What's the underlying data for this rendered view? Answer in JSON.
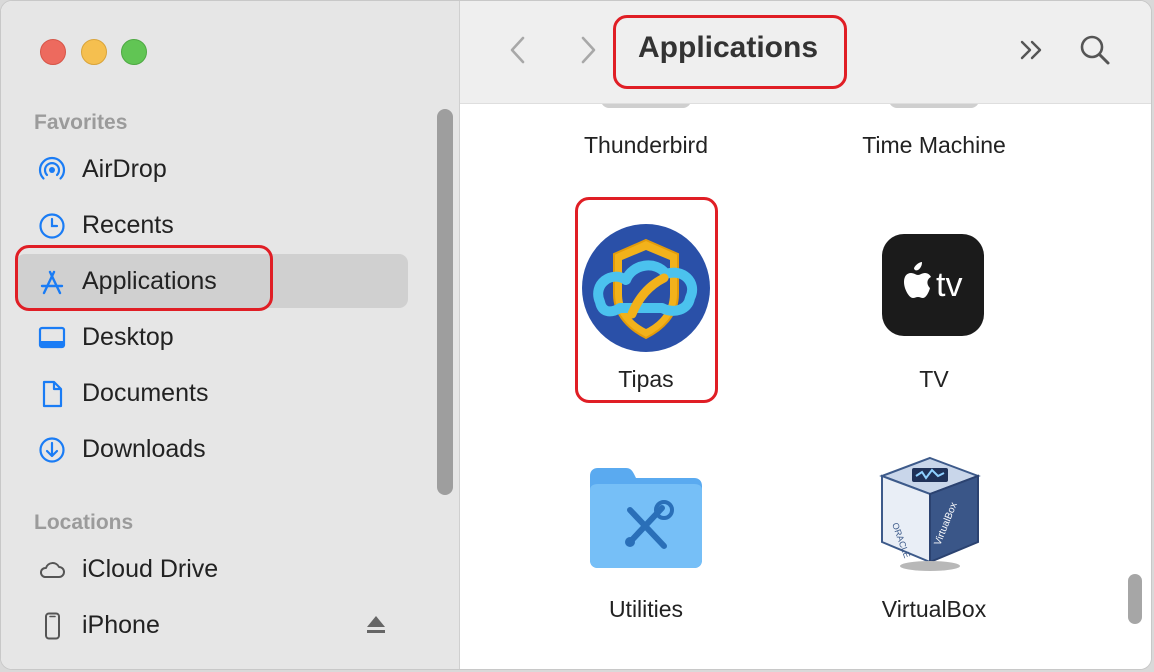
{
  "window": {
    "title": "Applications"
  },
  "sidebar": {
    "sections": [
      {
        "label": "Favorites"
      },
      {
        "label": "Locations"
      }
    ],
    "favorites": [
      {
        "label": "AirDrop",
        "icon": "airdrop-icon"
      },
      {
        "label": "Recents",
        "icon": "clock-icon"
      },
      {
        "label": "Applications",
        "icon": "applications-icon",
        "selected": true
      },
      {
        "label": "Desktop",
        "icon": "desktop-icon"
      },
      {
        "label": "Documents",
        "icon": "document-icon"
      },
      {
        "label": "Downloads",
        "icon": "download-icon"
      }
    ],
    "locations": [
      {
        "label": "iCloud Drive",
        "icon": "cloud-icon"
      },
      {
        "label": "iPhone",
        "icon": "iphone-icon"
      }
    ]
  },
  "files": [
    {
      "label": "Thunderbird"
    },
    {
      "label": "Time Machine"
    },
    {
      "label": "Tipas",
      "icon": "tipas-app-icon"
    },
    {
      "label": "TV",
      "icon": "apple-tv-app-icon"
    },
    {
      "label": "Utilities",
      "icon": "utilities-folder-icon"
    },
    {
      "label": "VirtualBox",
      "icon": "virtualbox-app-icon"
    }
  ],
  "colors": {
    "accent": "#1a7cf5",
    "annotation": "#e01e25",
    "sidebar_bg": "#e6e6e6",
    "selected_bg": "#d0d0d0"
  }
}
